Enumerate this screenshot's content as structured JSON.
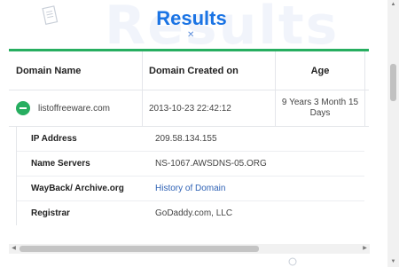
{
  "page": {
    "watermark": "Results",
    "title": "Results"
  },
  "table": {
    "headers": [
      "Domain Name",
      "Domain Created on",
      "Age"
    ],
    "rows": [
      {
        "domain": "listoffreeware.com",
        "created": "2013-10-23 22:42:12",
        "age": "9 Years 3 Month 15 Days"
      }
    ],
    "details": [
      {
        "label": "IP Address",
        "value": "209.58.134.155"
      },
      {
        "label": "Name Servers",
        "value": "NS-1067.AWSDNS-05.ORG"
      },
      {
        "label": "WayBack/ Archive.org",
        "value": "History of Domain"
      },
      {
        "label": "Registrar",
        "value": "GoDaddy.com, LLC"
      }
    ]
  },
  "colors": {
    "accent_green": "#27ae60",
    "title_blue": "#1b74e4",
    "link_blue": "#2f62b5"
  },
  "icons": {
    "collapse": "minus-circle-icon",
    "decor_doc": "document-icon",
    "decor_x": "x-mark-icon",
    "decor_circle": "circle-icon"
  },
  "scroll": {
    "vertical_position": 0.25,
    "horizontal_visible_fraction": 0.68
  }
}
